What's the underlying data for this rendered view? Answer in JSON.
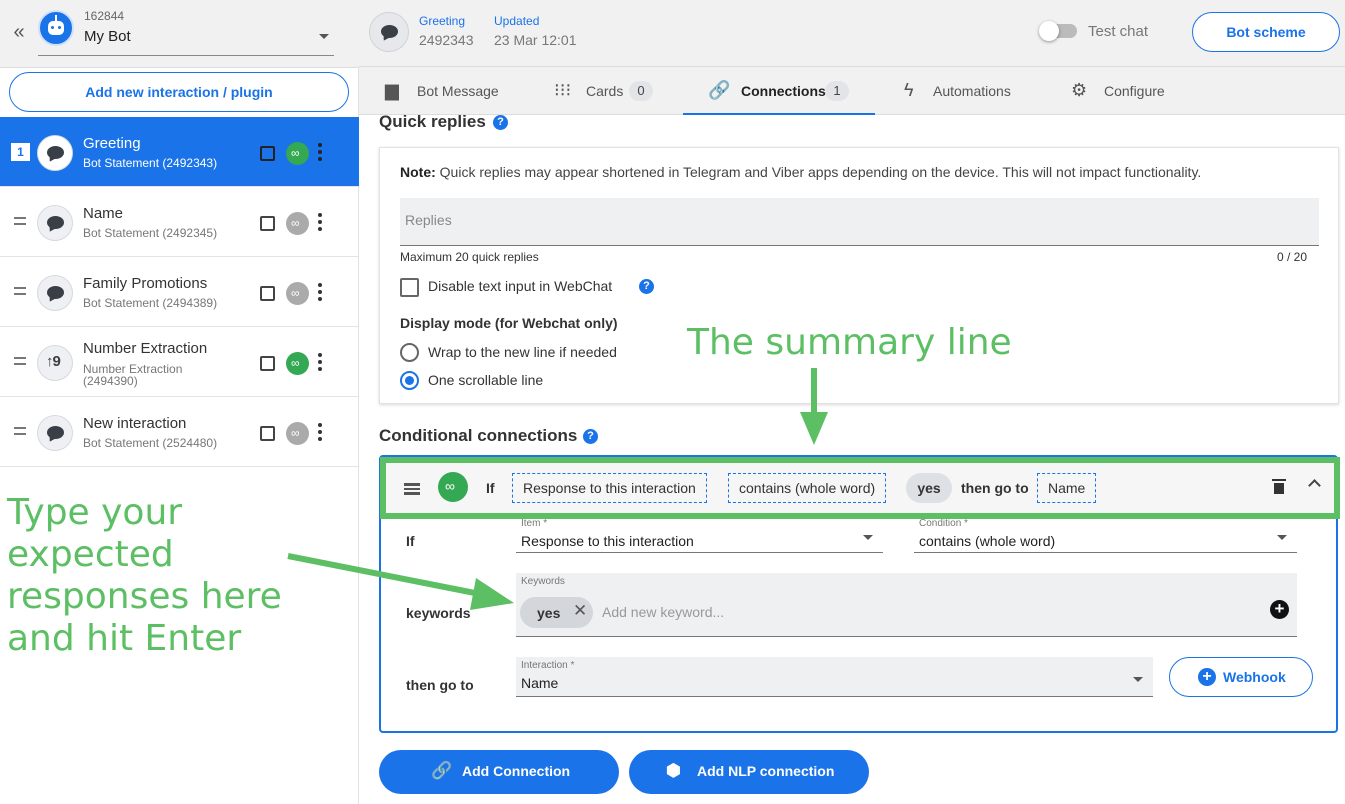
{
  "bot": {
    "id": "162844",
    "name": "My Bot",
    "collapse_icon": "«"
  },
  "sidebar": {
    "add_button": "Add new interaction / plugin",
    "items": [
      {
        "num": "1",
        "title": "Greeting",
        "sub": "Bot Statement (2492343)",
        "icon": "chat-bubble-icon",
        "link": "on"
      },
      {
        "title": "Name",
        "sub": "Bot Statement (2492345)",
        "icon": "chat-bubble-icon",
        "link": "off"
      },
      {
        "title": "Family Promotions",
        "sub": "Bot Statement (2494389)",
        "icon": "chat-bubble-icon",
        "link": "off"
      },
      {
        "title": "Number Extraction",
        "sub": "Number Extraction (2494390)",
        "icon": "number-extraction-icon",
        "link": "on"
      },
      {
        "title": "New interaction",
        "sub": "Bot Statement (2524480)",
        "icon": "chat-bubble-icon",
        "link": "off"
      }
    ]
  },
  "header": {
    "label1": "Greeting",
    "value1": "2492343",
    "label2": "Updated",
    "value2": "23 Mar 12:01",
    "test_chat": "Test chat",
    "bot_scheme": "Bot scheme"
  },
  "tabs": [
    {
      "label": "Bot Message",
      "icon": "message-icon"
    },
    {
      "label": "Cards",
      "count": "0",
      "icon": "grid-icon"
    },
    {
      "label": "Connections",
      "count": "1",
      "icon": "link-icon",
      "active": true
    },
    {
      "label": "Automations",
      "icon": "bolt-icon"
    },
    {
      "label": "Configure",
      "icon": "gear-icon"
    }
  ],
  "quick_replies": {
    "title": "Quick replies",
    "note_bold": "Note:",
    "note_text": " Quick replies may appear shortened in Telegram and Viber apps depending on the device. This will not impact functionality.",
    "placeholder": "Replies",
    "max_label": "Maximum 20 quick replies",
    "counter": "0 / 20",
    "disable_label": "Disable text input in WebChat",
    "display_mode_title": "Display mode (for Webchat only)",
    "radio1": "Wrap to the new line if needed",
    "radio2": "One scrollable line"
  },
  "conditional": {
    "title": "Conditional connections",
    "summary": {
      "if": "If",
      "item": "Response to this interaction",
      "condition": "contains (whole word)",
      "keyword": "yes",
      "then": "then go to",
      "target": "Name"
    },
    "form": {
      "if_label": "If",
      "item_label": "Item *",
      "item_value": "Response to this interaction",
      "condition_label": "Condition *",
      "condition_value": "contains (whole word)",
      "keywords_row": "keywords",
      "keywords_label": "Keywords",
      "keyword_chip": "yes",
      "keyword_placeholder": "Add new keyword...",
      "then_label": "then go to",
      "interaction_label": "Interaction *",
      "interaction_value": "Name",
      "webhook": "Webhook"
    },
    "add_connection": "Add Connection",
    "add_nlp": "Add NLP connection"
  },
  "annotations": {
    "summary": "The summary line",
    "type_hint": "Type your expected responses here and hit Enter",
    "color": "#5cbf63"
  },
  "colors": {
    "accent": "#1a73e8",
    "link_on": "#34a853"
  }
}
